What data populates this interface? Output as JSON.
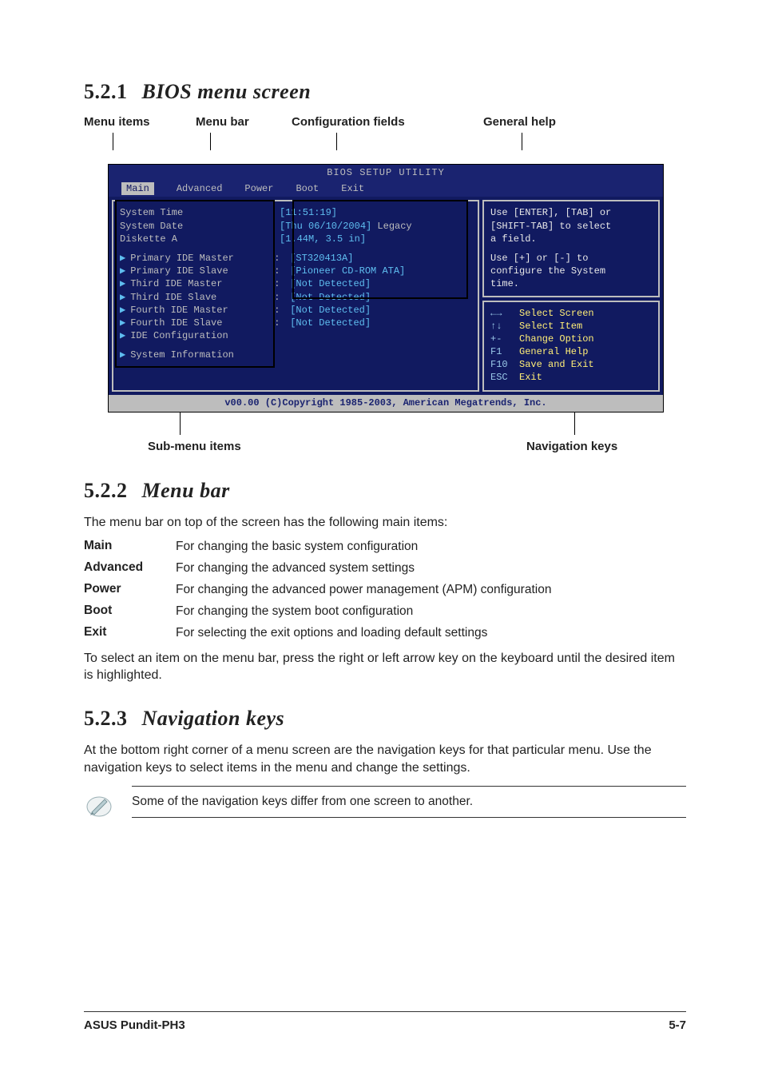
{
  "headings": {
    "s521_num": "5.2.1",
    "s521_title": "BIOS menu screen",
    "s522_num": "5.2.2",
    "s522_title": "Menu bar",
    "s523_num": "5.2.3",
    "s523_title": "Navigation keys"
  },
  "callouts": {
    "menu_items": "Menu items",
    "menu_bar": "Menu bar",
    "config_fields": "Configuration fields",
    "general_help": "General help",
    "submenu_items": "Sub-menu items",
    "nav_keys": "Navigation keys"
  },
  "bios": {
    "title": "BIOS SETUP UTILITY",
    "menu": {
      "main": "Main",
      "advanced": "Advanced",
      "power": "Power",
      "boot": "Boot",
      "exit": "Exit"
    },
    "left": {
      "sys_time_l": "System Time",
      "sys_time_v": "[11:51:19]",
      "sys_date_l": "System Date",
      "sys_date_v": "[Thu 06/10/2004]",
      "legacy": "Legacy",
      "diskette_l": "Diskette A",
      "diskette_v": "[1.44M, 3.5 in]",
      "pim_l": "Primary IDE Master",
      "pim_v": "[ST320413A]",
      "pis_l": "Primary IDE Slave",
      "pis_v": "[Pioneer CD-ROM ATA]",
      "tidm_l": "Third IDE Master",
      "tidm_v": "[Not Detected]",
      "tids_l": "Third IDE Slave",
      "tids_v": "[Not Detected]",
      "fidm_l": "Fourth IDE Master",
      "fidm_v": "[Not Detected]",
      "fids_l": "Fourth IDE Slave",
      "fids_v": "[Not Detected]",
      "idecfg_l": "IDE Configuration",
      "sysinfo_l": "System Information"
    },
    "help": {
      "l1": "Use [ENTER], [TAB] or",
      "l2": "[SHIFT-TAB] to select",
      "l3": "a field.",
      "l4": "Use [+] or [-] to",
      "l5": "configure the System",
      "l6": "time."
    },
    "nav": {
      "k1": "←→",
      "t1": "Select Screen",
      "k2": "↑↓",
      "t2": "Select Item",
      "k3": "+-",
      "t3": "Change Option",
      "k4": "F1",
      "t4": "General Help",
      "k5": "F10",
      "t5": "Save and Exit",
      "k6": "ESC",
      "t6": "Exit"
    },
    "footer": "v00.00 (C)Copyright 1985-2003, American Megatrends, Inc."
  },
  "s522_intro": "The menu bar on top of the screen has the following main items:",
  "menutbl": {
    "main_k": "Main",
    "main_v": "For changing the basic system configuration",
    "adv_k": "Advanced",
    "adv_v": "For changing the advanced system settings",
    "pow_k": "Power",
    "pow_v": "For changing the advanced power management (APM) configuration",
    "boot_k": "Boot",
    "boot_v": "For changing the system boot configuration",
    "exit_k": "Exit",
    "exit_v": "For selecting the exit options and loading default settings"
  },
  "s522_out": "To select an item on the menu bar, press the right or left arrow key on the keyboard until the desired item is highlighted.",
  "s523_p": "At the bottom right corner of a menu screen are the navigation keys for that particular menu. Use the navigation keys to select items in the menu and change the settings.",
  "note": "Some of the navigation keys differ from one screen to another.",
  "footer": {
    "left": "ASUS Pundit-PH3",
    "right": "5-7"
  }
}
